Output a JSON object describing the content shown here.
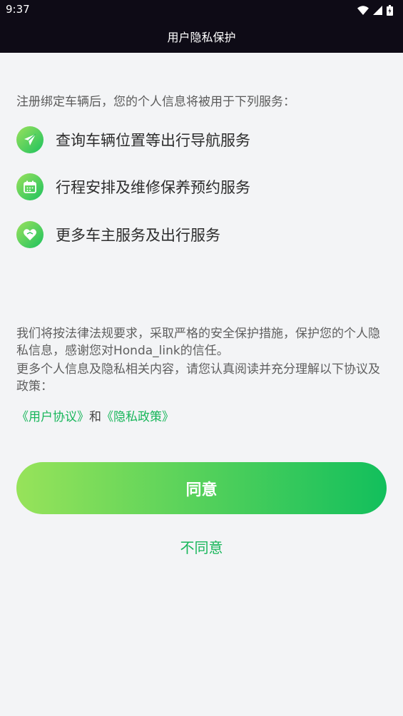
{
  "status": {
    "time": "9:37"
  },
  "header": {
    "title": "用户隐私保护"
  },
  "intro": "注册绑定车辆后，您的个人信息将被用于下列服务：",
  "services": [
    {
      "label": "查询车辆位置等出行导航服务",
      "icon": "paper-plane-icon"
    },
    {
      "label": "行程安排及维修保养预约服务",
      "icon": "calendar-icon"
    },
    {
      "label": "更多车主服务及出行服务",
      "icon": "heart-icon"
    }
  ],
  "notice": {
    "p1": "我们将按法律法规要求，采取严格的安全保护措施，保护您的个人隐私信息，感谢您对Honda_link的信任。",
    "p2": "更多个人信息及隐私相关内容，请您认真阅读并充分理解以下协议及政策："
  },
  "links": {
    "user_agreement": "《用户协议》",
    "and": "和",
    "privacy_policy": "《隐私政策》"
  },
  "buttons": {
    "agree": "同意",
    "disagree": "不同意"
  },
  "colors": {
    "accent": "#17b65a",
    "gradient_start": "#97e35a",
    "gradient_end": "#12bf5c",
    "topbar": "#0e0b16"
  }
}
